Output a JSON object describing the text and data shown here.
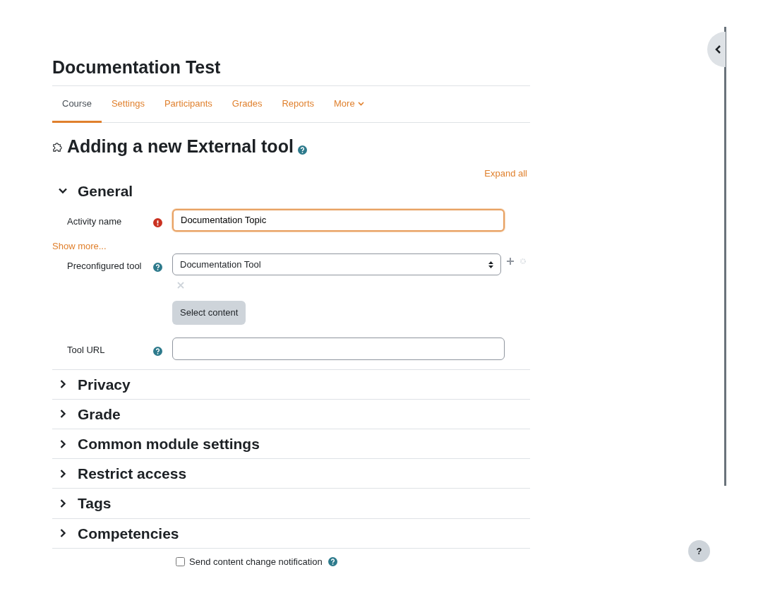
{
  "page_title": "Documentation Test",
  "tabs": [
    {
      "label": "Course",
      "selected": true,
      "kind": "link"
    },
    {
      "label": "Settings",
      "selected": false,
      "kind": "link"
    },
    {
      "label": "Participants",
      "selected": false,
      "kind": "link"
    },
    {
      "label": "Grades",
      "selected": false,
      "kind": "link"
    },
    {
      "label": "Reports",
      "selected": false,
      "kind": "link"
    },
    {
      "label": "More",
      "selected": false,
      "kind": "dropdown"
    }
  ],
  "heading": "Adding a new External tool",
  "expand_all": "Expand all",
  "sections": [
    {
      "title": "General",
      "expanded": true,
      "fields": [
        {
          "kind": "text",
          "label": "Activity name",
          "required": true,
          "help": false,
          "value": "Documentation Topic",
          "focused": true
        },
        {
          "kind": "link",
          "label": "Show more..."
        },
        {
          "kind": "select",
          "label": "Preconfigured tool",
          "required": false,
          "help": true,
          "value": "Documentation Tool",
          "button": "Select content"
        },
        {
          "kind": "text",
          "label": "Tool URL",
          "required": false,
          "help": true,
          "focused": false
        }
      ]
    },
    {
      "title": "Privacy",
      "expanded": false
    },
    {
      "title": "Grade",
      "expanded": false
    },
    {
      "title": "Common module settings",
      "expanded": false
    },
    {
      "title": "Restrict access",
      "expanded": false
    },
    {
      "title": "Tags",
      "expanded": false
    },
    {
      "title": "Competencies",
      "expanded": false
    }
  ],
  "notification": {
    "label": "Send content change notification",
    "checked": false
  },
  "help_button": "?"
}
